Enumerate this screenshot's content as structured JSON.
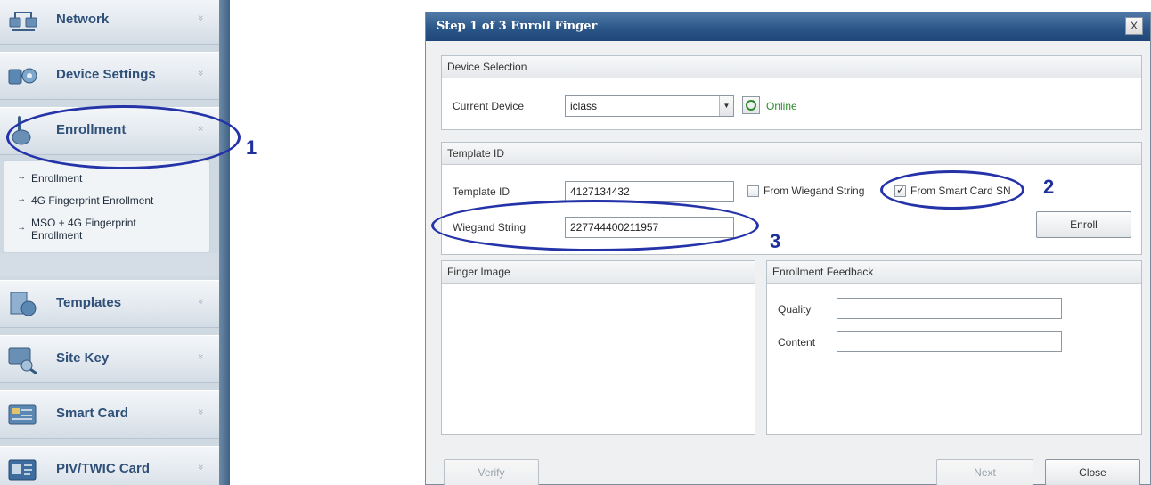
{
  "sidebar": {
    "items": [
      {
        "label": "Network",
        "icon": "network-icon"
      },
      {
        "label": "Device Settings",
        "icon": "device-settings-icon"
      },
      {
        "label": "Enrollment",
        "icon": "enrollment-icon"
      },
      {
        "label": "Templates",
        "icon": "templates-icon"
      },
      {
        "label": "Site Key",
        "icon": "site-key-icon"
      },
      {
        "label": "Smart Card",
        "icon": "smart-card-icon"
      },
      {
        "label": "PIV/TWIC Card",
        "icon": "piv-card-icon"
      }
    ],
    "enrollment_subitems": [
      {
        "label": "Enrollment"
      },
      {
        "label": "4G Fingerprint Enrollment"
      },
      {
        "label": "MSO + 4G Fingerprint Enrollment"
      }
    ],
    "chevron_down": "»",
    "chevron_up": "«",
    "subitem_arrow": "→"
  },
  "dialog": {
    "title": "Step 1 of 3 Enroll Finger",
    "close_label": "X",
    "device_selection": {
      "header": "Device Selection",
      "current_device_label": "Current Device",
      "current_device_value": "iclass",
      "combo_arrow": "▼",
      "status": "Online"
    },
    "template_section": {
      "header": "Template ID",
      "template_id_label": "Template ID",
      "template_id_value": "4127134432",
      "from_wiegand_label": "From Wiegand String",
      "from_wiegand_checked": false,
      "from_smartcard_label": "From Smart Card SN",
      "from_smartcard_checked": true,
      "wiegand_label": "Wiegand String",
      "wiegand_value": "227744400211957",
      "enroll_label": "Enroll"
    },
    "finger_image": {
      "header": "Finger Image"
    },
    "feedback": {
      "header": "Enrollment Feedback",
      "quality_label": "Quality",
      "quality_value": "",
      "content_label": "Content",
      "content_value": ""
    },
    "buttons": {
      "verify": "Verify",
      "next": "Next",
      "close": "Close"
    }
  },
  "annotations": {
    "one": "1",
    "two": "2",
    "three": "3",
    "color": "#2433a8"
  },
  "colors": {
    "title_bar": "#2b5789",
    "sidebar_label": "#2f5078",
    "online": "#2e8b2e"
  }
}
